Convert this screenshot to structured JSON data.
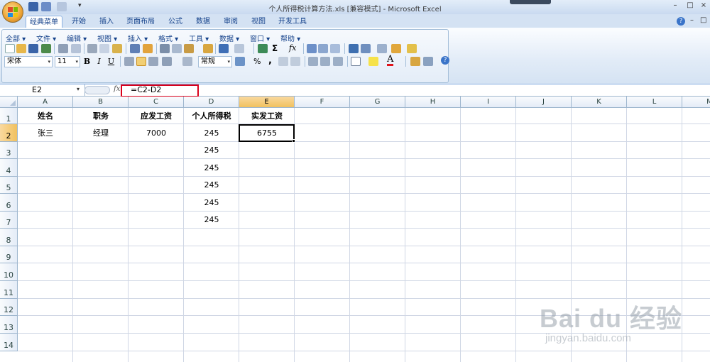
{
  "window": {
    "title": "个人所得税计算方法.xls  [兼容模式] - Microsoft Excel",
    "controls": [
      "–",
      "□",
      "×"
    ]
  },
  "tabs": [
    "经典菜单",
    "开始",
    "插入",
    "页面布局",
    "公式",
    "数据",
    "审阅",
    "视图",
    "开发工具"
  ],
  "active_tab": "经典菜单",
  "menu": [
    "全部",
    "文件",
    "编辑",
    "视图",
    "插入",
    "格式",
    "工具",
    "数据",
    "窗口",
    "帮助"
  ],
  "font": {
    "name": "宋体",
    "size": "11"
  },
  "format_buttons": [
    "B",
    "I",
    "U"
  ],
  "number_format": "常规",
  "percent": "%",
  "comma": ",",
  "name_box": "E2",
  "fx": "fx",
  "formula": "=C2-D2",
  "columns": [
    "A",
    "B",
    "C",
    "D",
    "E",
    "F",
    "G",
    "H",
    "I",
    "J",
    "K",
    "L",
    "M"
  ],
  "selected_column": "E",
  "rows": [
    "1",
    "2",
    "3",
    "4",
    "5",
    "6",
    "7",
    "8",
    "9",
    "10",
    "11",
    "12",
    "13",
    "14"
  ],
  "selected_row": "2",
  "cells": {
    "A1": "姓名",
    "B1": "职务",
    "C1": "应发工资",
    "D1": "个人所得税",
    "E1": "实发工资",
    "A2": "张三",
    "B2": "经理",
    "C2": "7000",
    "D2": "245",
    "E2": "6755",
    "D3": "245",
    "D4": "245",
    "D5": "245",
    "D6": "245",
    "D7": "245"
  },
  "watermark": {
    "brand": "Bai du 经验",
    "url": "jingyan.baidu.com"
  },
  "colors": {
    "accent": "#d9001b",
    "selected_header": "#f1c15f",
    "ribbon": "#dfe9f5"
  }
}
